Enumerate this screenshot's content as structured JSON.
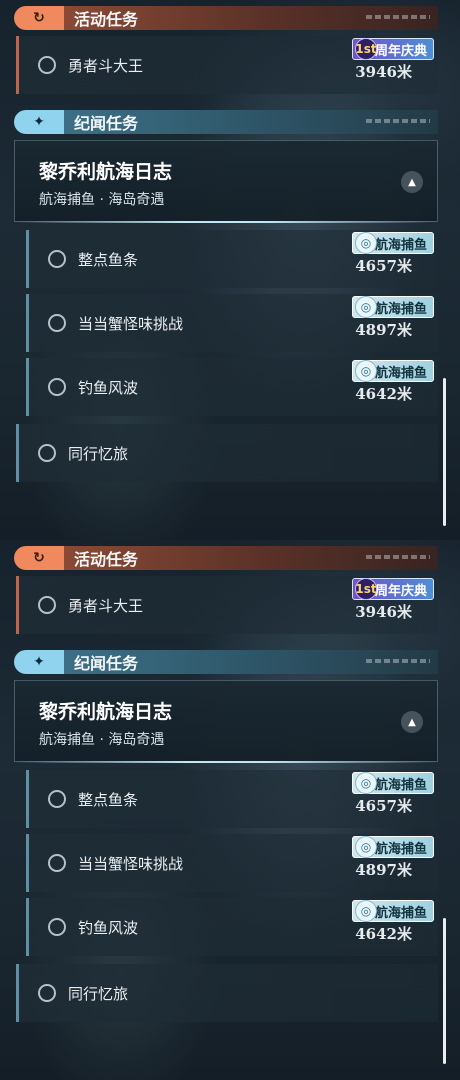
{
  "panels": [
    {
      "activity_header": {
        "icon": "rotate-arrow-icon",
        "icon_glyph": "↻",
        "title": "活动任务"
      },
      "activity_task": {
        "label": "勇者斗大王",
        "distance": "3946米",
        "badge": "周年庆典",
        "badge_icon": "1st"
      },
      "story_header": {
        "icon": "sparkle-icon",
        "icon_glyph": "✦",
        "title": "纪闻任务"
      },
      "story_card": {
        "title": "黎乔利航海日志",
        "subtitle": "航海捕鱼 · 海岛奇遇",
        "collapse_glyph": "▲"
      },
      "story_tasks": [
        {
          "label": "整点鱼条",
          "distance": "4657米",
          "badge": "航海捕鱼"
        },
        {
          "label": "当当蟹怪味挑战",
          "distance": "4897米",
          "badge": "航海捕鱼"
        },
        {
          "label": "钓鱼风波",
          "distance": "4642米",
          "badge": "航海捕鱼"
        }
      ],
      "other_task": {
        "label": "同行忆旅"
      }
    },
    {
      "activity_header": {
        "icon": "rotate-arrow-icon",
        "icon_glyph": "↻",
        "title": "活动任务"
      },
      "activity_task": {
        "label": "勇者斗大王",
        "distance": "3946米",
        "badge": "周年庆典",
        "badge_icon": "1st"
      },
      "story_header": {
        "icon": "sparkle-icon",
        "icon_glyph": "✦",
        "title": "纪闻任务"
      },
      "story_card": {
        "title": "黎乔利航海日志",
        "subtitle": "航海捕鱼 · 海岛奇遇",
        "collapse_glyph": "▲"
      },
      "story_tasks": [
        {
          "label": "整点鱼条",
          "distance": "4657米",
          "badge": "航海捕鱼"
        },
        {
          "label": "当当蟹怪味挑战",
          "distance": "4897米",
          "badge": "航海捕鱼"
        },
        {
          "label": "钓鱼风波",
          "distance": "4642米",
          "badge": "航海捕鱼"
        }
      ],
      "other_task": {
        "label": "同行忆旅"
      }
    }
  ],
  "colors": {
    "activity_accent": "#f08a5e",
    "story_accent": "#8fd3ee",
    "row_accent": "#5f8fa3",
    "activity_row_accent": "#c0654a"
  }
}
